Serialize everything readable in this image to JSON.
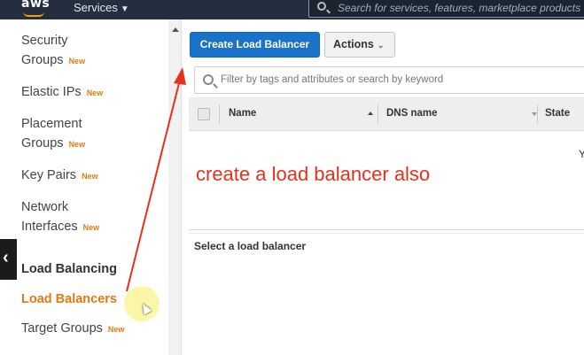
{
  "topbar": {
    "logo": "aws",
    "services_label": "Services",
    "search_placeholder": "Search for services, features, marketplace products"
  },
  "sidebar": {
    "items": [
      {
        "line1": "Security",
        "line2": "Groups",
        "badge": "New"
      },
      {
        "line1": "Elastic IPs",
        "badge": "New"
      },
      {
        "line1": "Placement",
        "line2": "Groups",
        "badge": "New"
      },
      {
        "line1": "Key Pairs",
        "badge": "New"
      },
      {
        "line1": "Network",
        "line2": "Interfaces",
        "badge": "New"
      }
    ],
    "section_heading": "Load Balancing",
    "active_item": "Load Balancers",
    "target_groups": {
      "label": "Target Groups",
      "badge": "New"
    }
  },
  "toolbar": {
    "create_label": "Create Load Balancer",
    "actions_label": "Actions"
  },
  "filter": {
    "placeholder": "Filter by tags and attributes or search by keyword"
  },
  "table": {
    "columns": [
      "Name",
      "DNS name",
      "State"
    ],
    "partial_text": "Y"
  },
  "annotation": {
    "text": "create a load balancer also",
    "color": "#e8311b"
  },
  "details": {
    "prompt": "Select a load balancer"
  },
  "colors": {
    "topbar": "#232f3e",
    "primary_button": "#1a73c8",
    "new_badge": "#e47911",
    "active_nav": "#e47911"
  }
}
